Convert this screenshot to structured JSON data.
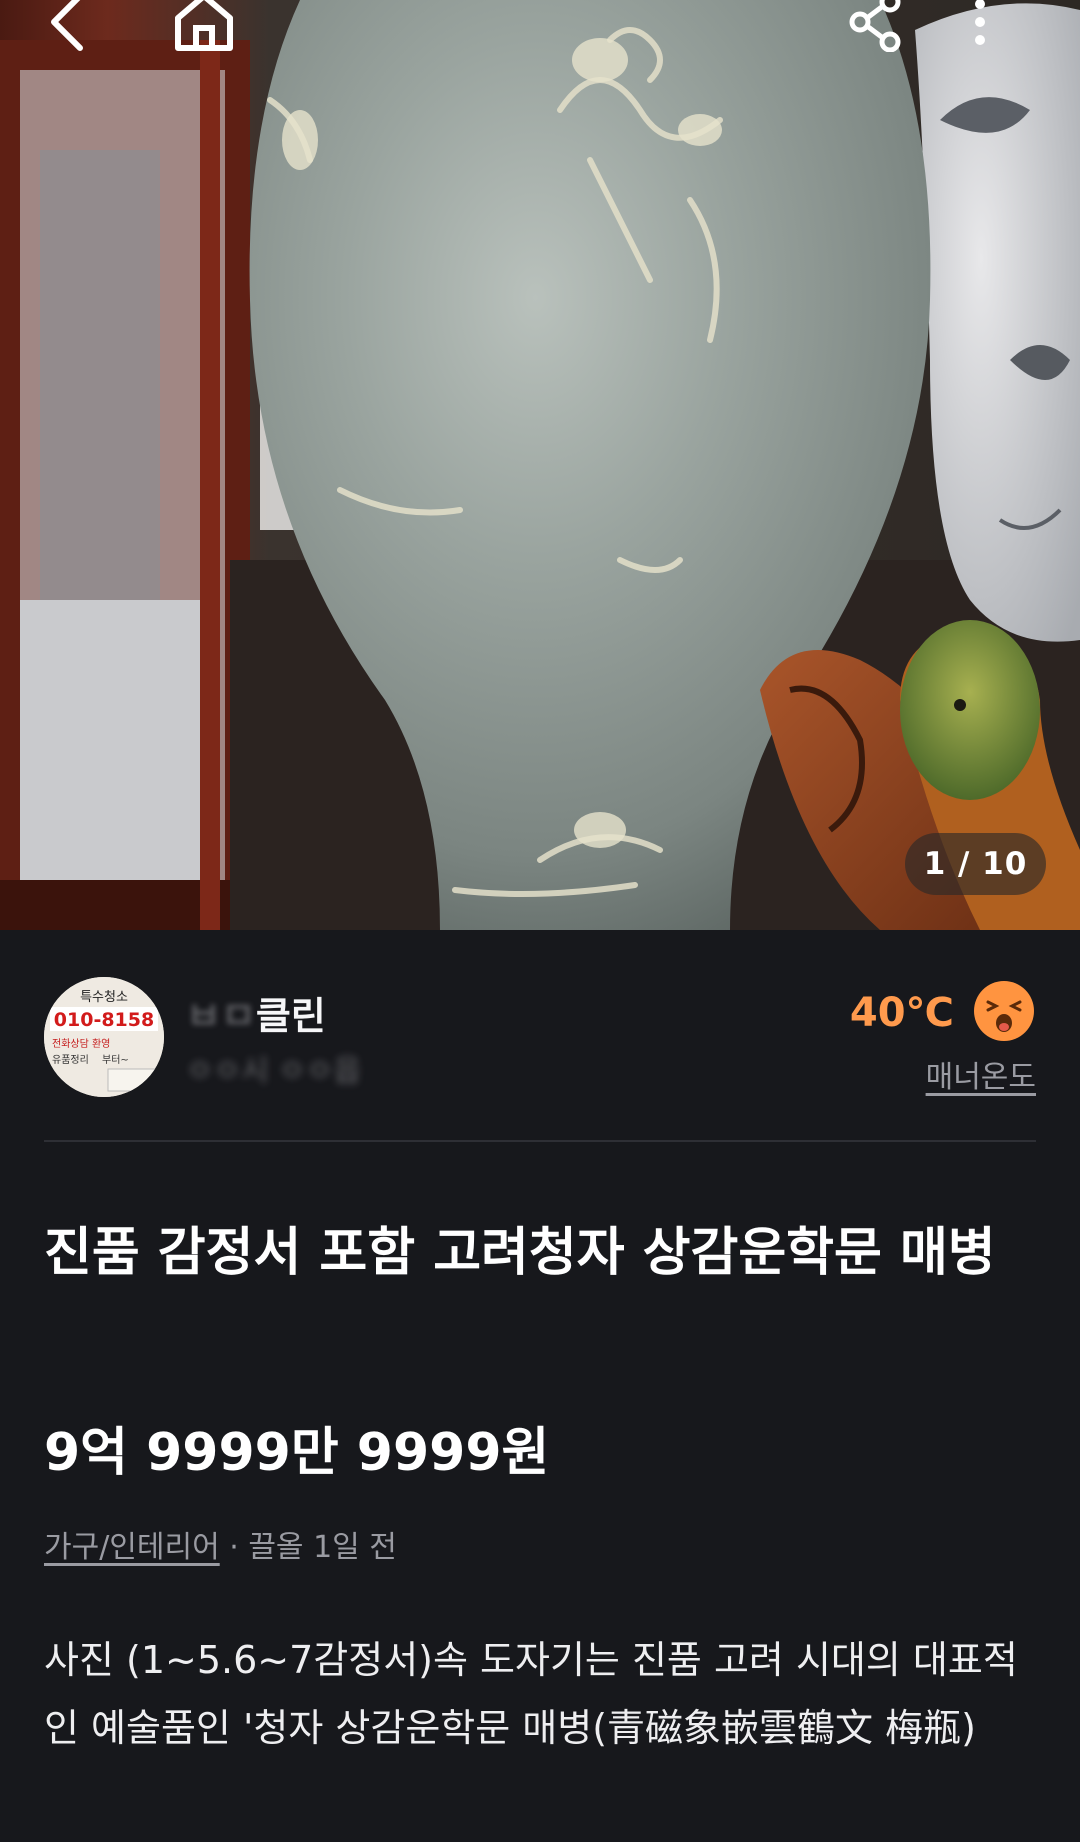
{
  "photo": {
    "counter": "1 / 10"
  },
  "topbar": {
    "back_icon": "chevron-left-icon",
    "home_icon": "home-icon",
    "share_icon": "share-icon",
    "more_icon": "more-vertical-icon"
  },
  "seller": {
    "avatar_text": {
      "top": "특수청소",
      "phone": "010-8158",
      "line1": "전화상담 환영",
      "line2": "유품정리",
      "line3": "부터~"
    },
    "name_hidden": "ㅂㅁ",
    "name_visible": "클린",
    "location_hidden": "ㅇㅇ시 ㅇㅇ읍",
    "temperature": "40℃",
    "manner_label": "매너온도"
  },
  "listing": {
    "title": "진품 감정서 포함 고려청자 상감운학문 매병",
    "price": "9억 9999만 9999원",
    "category": "가구/인테리어",
    "separator": " · ",
    "bumped": "끌올 1일 전",
    "description": "사진 (1~5.6~7감정서)속 도자기는 진품 고려 시대의 대표적인 예술품인 '청자 상감운학문 매병(青磁象嵌雲鶴文 梅瓶)"
  },
  "colors": {
    "background": "#17181c",
    "temperature": "#ff9a4d",
    "muted": "#9a9ba2"
  }
}
